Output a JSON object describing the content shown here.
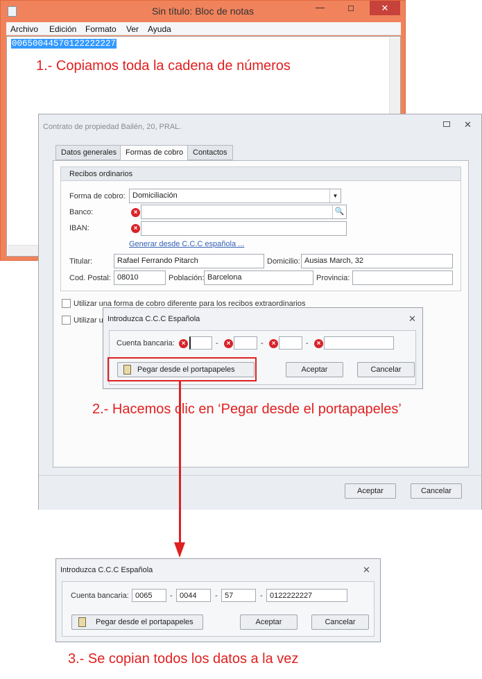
{
  "notepad": {
    "title": "Sin título: Bloc de notas",
    "menu": [
      "Archivo",
      "Edición",
      "Formato",
      "Ver",
      "Ayuda"
    ],
    "content": "00650044570122222227",
    "minimize": "—",
    "maximize": "☐",
    "close": "✕"
  },
  "steps": {
    "step1": "1.- Copiamos toda la cadena de números",
    "step2": "2.- Hacemos clic en ‘Pegar desde el portapapeles’",
    "step3": "3.- Se copian todos los datos a la vez"
  },
  "contract": {
    "title": "Contrato de propiedad Bailén, 20, PRAL.",
    "close": "✕",
    "tabs": [
      "Datos generales",
      "Formas de cobro",
      "Contactos"
    ],
    "active_tab": "Formas de cobro",
    "group_title": "Recibos ordinarios",
    "forma_cobro_label": "Forma de cobro:",
    "forma_cobro_value": "Domiciliación",
    "banco_label": "Banco:",
    "iban_label": "IBAN:",
    "generate_link": "Generar desde C.C.C española ...",
    "titular_label": "Titular:",
    "titular_value": "Rafael Ferrando Pitarch",
    "domicilio_label": "Domicilio:",
    "domicilio_value": "Ausias March, 32",
    "cp_label": "Cod. Postal:",
    "cp_value": "08010",
    "poblacion_label": "Población:",
    "poblacion_value": "Barcelona",
    "provincia_label": "Provincia:",
    "provincia_value": "",
    "checkbox1": "Utilizar una forma de cobro diferente para los recibos extraordinarios",
    "checkbox2": "Utilizar un",
    "accept": "Aceptar",
    "cancel": "Cancelar"
  },
  "ccc_dialog_1": {
    "title": "Introduzca C.C.C Española",
    "close": "✕",
    "account_label": "Cuenta bancaria:",
    "fields": [
      "",
      "",
      "",
      ""
    ],
    "paste_button": "Pegar desde el portapapeles",
    "accept": "Aceptar",
    "cancel": "Cancelar"
  },
  "ccc_dialog_2": {
    "title": "Introduzca C.C.C Española",
    "close": "✕",
    "account_label": "Cuenta bancaria:",
    "fields": [
      "0065",
      "0044",
      "57",
      "0122222227"
    ],
    "paste_button": "Pegar desde el portapapeles",
    "accept": "Aceptar",
    "cancel": "Cancelar"
  },
  "colors": {
    "notepad_frame": "#f0835c",
    "annotation_red": "#e02020",
    "selection": "#3399ff",
    "error_icon": "#d8232a",
    "link": "#3561b3"
  },
  "icons": [
    "notepad-app-icon",
    "error-icon",
    "search-icon",
    "clipboard-icon",
    "dropdown-arrow-icon",
    "close-icon",
    "restore-icon"
  ]
}
